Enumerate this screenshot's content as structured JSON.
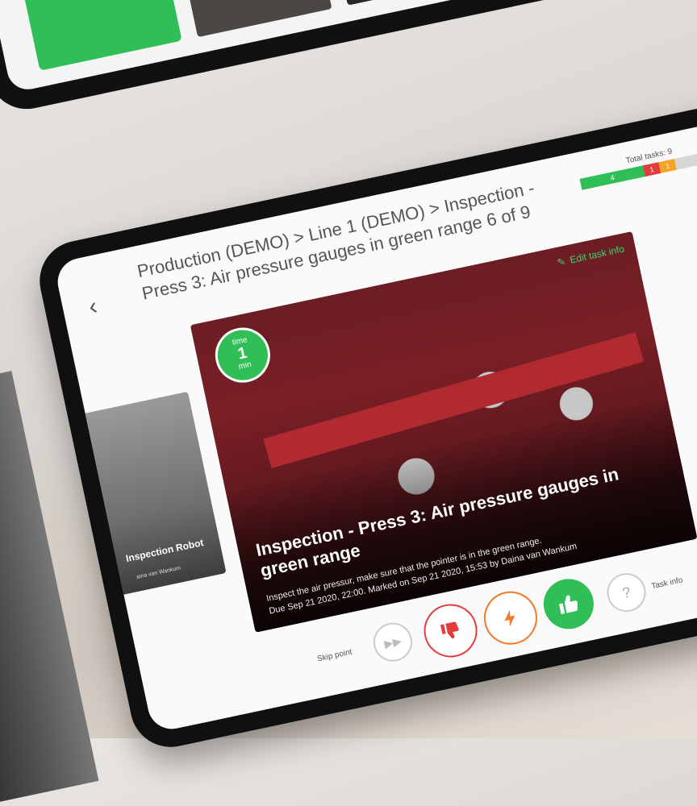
{
  "top_device": {
    "thumb_colors": [
      "#2fbf56",
      "#4a4744",
      "#2a2623"
    ]
  },
  "header": {
    "back_icon": "chevron-left-icon",
    "breadcrumb": "Production (DEMO) > Line 1 (DEMO) > Inspection - Press 3: Air pressure gauges in green range 6 of 9",
    "tasks_label": "Total tasks: 9",
    "progress": [
      {
        "value": 4,
        "label": "4",
        "color": "#2fbf56"
      },
      {
        "value": 1,
        "label": "1",
        "color": "#e23c3c"
      },
      {
        "value": 1,
        "label": "1",
        "color": "#f5a524"
      },
      {
        "value": 3,
        "label": "",
        "color": "#d6d6d6"
      }
    ]
  },
  "main": {
    "edit_label": "Edit task info",
    "edit_icon": "pencil-icon",
    "time_badge": {
      "top": "time",
      "value": "1",
      "unit": "min"
    },
    "title": "Inspection - Press 3: Air pressure gauges in green range",
    "description_line1": "Inspect the air pressur, make sure that the pointer is in the green range.",
    "description_line2": "Due Sep 21 2020, 22:00. Marked on Sep 21 2020, 15:53 by Daina van Wankum"
  },
  "side_left": {
    "label": "Inspection Robot",
    "sub": "aina van Wankum"
  },
  "actions": {
    "skip_label": "Skip point",
    "skip_icon": "fast-forward-icon",
    "down_icon": "thumbs-down-icon",
    "bolt_icon": "lightning-icon",
    "up_icon": "thumbs-up-icon",
    "help_icon": "question-icon",
    "help_glyph": "?",
    "task_info_label": "Task info"
  },
  "colors": {
    "accent_green": "#2fbf56",
    "danger_red": "#e23c3c",
    "warning_orange": "#f07a2a"
  }
}
